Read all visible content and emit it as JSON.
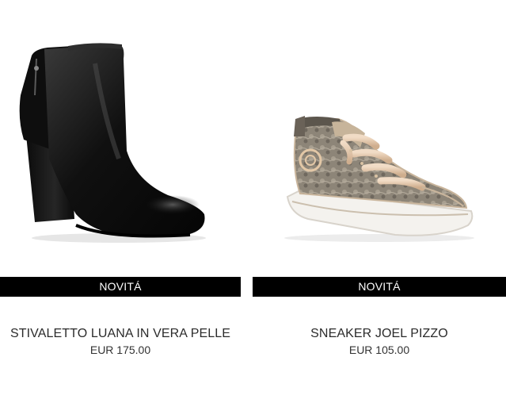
{
  "products": [
    {
      "badge": "NOVITÁ",
      "name": "STIVALETTO LUANA IN VERA PELLE",
      "price": "EUR 175.00",
      "image_icon": "ankle-boot-image"
    },
    {
      "badge": "NOVITÁ",
      "name": "SNEAKER JOEL PIZZO",
      "price": "EUR 105.00",
      "image_icon": "lace-sneaker-image"
    }
  ],
  "colors": {
    "badge_background": "#000000",
    "badge_text": "#ffffff",
    "boot_leather": "#141414",
    "sneaker_lace": "#8a8276",
    "sneaker_laces": "#e8cdb2",
    "sneaker_sole": "#f4f2ee"
  }
}
